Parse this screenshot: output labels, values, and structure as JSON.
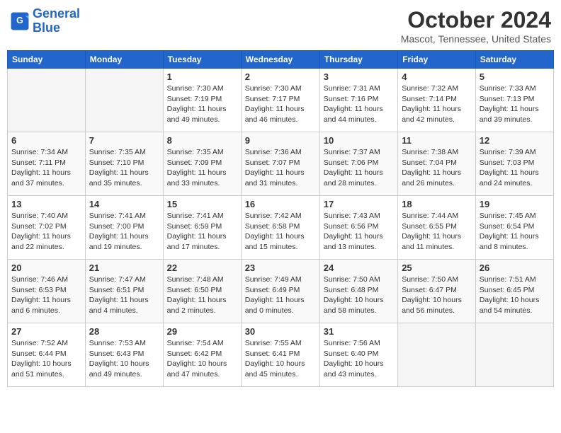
{
  "header": {
    "logo_line1": "General",
    "logo_line2": "Blue",
    "month": "October 2024",
    "location": "Mascot, Tennessee, United States"
  },
  "days_of_week": [
    "Sunday",
    "Monday",
    "Tuesday",
    "Wednesday",
    "Thursday",
    "Friday",
    "Saturday"
  ],
  "weeks": [
    [
      {
        "num": "",
        "sunrise": "",
        "sunset": "",
        "daylight": "",
        "empty": true
      },
      {
        "num": "",
        "sunrise": "",
        "sunset": "",
        "daylight": "",
        "empty": true
      },
      {
        "num": "1",
        "sunrise": "Sunrise: 7:30 AM",
        "sunset": "Sunset: 7:19 PM",
        "daylight": "Daylight: 11 hours and 49 minutes."
      },
      {
        "num": "2",
        "sunrise": "Sunrise: 7:30 AM",
        "sunset": "Sunset: 7:17 PM",
        "daylight": "Daylight: 11 hours and 46 minutes."
      },
      {
        "num": "3",
        "sunrise": "Sunrise: 7:31 AM",
        "sunset": "Sunset: 7:16 PM",
        "daylight": "Daylight: 11 hours and 44 minutes."
      },
      {
        "num": "4",
        "sunrise": "Sunrise: 7:32 AM",
        "sunset": "Sunset: 7:14 PM",
        "daylight": "Daylight: 11 hours and 42 minutes."
      },
      {
        "num": "5",
        "sunrise": "Sunrise: 7:33 AM",
        "sunset": "Sunset: 7:13 PM",
        "daylight": "Daylight: 11 hours and 39 minutes."
      }
    ],
    [
      {
        "num": "6",
        "sunrise": "Sunrise: 7:34 AM",
        "sunset": "Sunset: 7:11 PM",
        "daylight": "Daylight: 11 hours and 37 minutes."
      },
      {
        "num": "7",
        "sunrise": "Sunrise: 7:35 AM",
        "sunset": "Sunset: 7:10 PM",
        "daylight": "Daylight: 11 hours and 35 minutes."
      },
      {
        "num": "8",
        "sunrise": "Sunrise: 7:35 AM",
        "sunset": "Sunset: 7:09 PM",
        "daylight": "Daylight: 11 hours and 33 minutes."
      },
      {
        "num": "9",
        "sunrise": "Sunrise: 7:36 AM",
        "sunset": "Sunset: 7:07 PM",
        "daylight": "Daylight: 11 hours and 31 minutes."
      },
      {
        "num": "10",
        "sunrise": "Sunrise: 7:37 AM",
        "sunset": "Sunset: 7:06 PM",
        "daylight": "Daylight: 11 hours and 28 minutes."
      },
      {
        "num": "11",
        "sunrise": "Sunrise: 7:38 AM",
        "sunset": "Sunset: 7:04 PM",
        "daylight": "Daylight: 11 hours and 26 minutes."
      },
      {
        "num": "12",
        "sunrise": "Sunrise: 7:39 AM",
        "sunset": "Sunset: 7:03 PM",
        "daylight": "Daylight: 11 hours and 24 minutes."
      }
    ],
    [
      {
        "num": "13",
        "sunrise": "Sunrise: 7:40 AM",
        "sunset": "Sunset: 7:02 PM",
        "daylight": "Daylight: 11 hours and 22 minutes."
      },
      {
        "num": "14",
        "sunrise": "Sunrise: 7:41 AM",
        "sunset": "Sunset: 7:00 PM",
        "daylight": "Daylight: 11 hours and 19 minutes."
      },
      {
        "num": "15",
        "sunrise": "Sunrise: 7:41 AM",
        "sunset": "Sunset: 6:59 PM",
        "daylight": "Daylight: 11 hours and 17 minutes."
      },
      {
        "num": "16",
        "sunrise": "Sunrise: 7:42 AM",
        "sunset": "Sunset: 6:58 PM",
        "daylight": "Daylight: 11 hours and 15 minutes."
      },
      {
        "num": "17",
        "sunrise": "Sunrise: 7:43 AM",
        "sunset": "Sunset: 6:56 PM",
        "daylight": "Daylight: 11 hours and 13 minutes."
      },
      {
        "num": "18",
        "sunrise": "Sunrise: 7:44 AM",
        "sunset": "Sunset: 6:55 PM",
        "daylight": "Daylight: 11 hours and 11 minutes."
      },
      {
        "num": "19",
        "sunrise": "Sunrise: 7:45 AM",
        "sunset": "Sunset: 6:54 PM",
        "daylight": "Daylight: 11 hours and 8 minutes."
      }
    ],
    [
      {
        "num": "20",
        "sunrise": "Sunrise: 7:46 AM",
        "sunset": "Sunset: 6:53 PM",
        "daylight": "Daylight: 11 hours and 6 minutes."
      },
      {
        "num": "21",
        "sunrise": "Sunrise: 7:47 AM",
        "sunset": "Sunset: 6:51 PM",
        "daylight": "Daylight: 11 hours and 4 minutes."
      },
      {
        "num": "22",
        "sunrise": "Sunrise: 7:48 AM",
        "sunset": "Sunset: 6:50 PM",
        "daylight": "Daylight: 11 hours and 2 minutes."
      },
      {
        "num": "23",
        "sunrise": "Sunrise: 7:49 AM",
        "sunset": "Sunset: 6:49 PM",
        "daylight": "Daylight: 11 hours and 0 minutes."
      },
      {
        "num": "24",
        "sunrise": "Sunrise: 7:50 AM",
        "sunset": "Sunset: 6:48 PM",
        "daylight": "Daylight: 10 hours and 58 minutes."
      },
      {
        "num": "25",
        "sunrise": "Sunrise: 7:50 AM",
        "sunset": "Sunset: 6:47 PM",
        "daylight": "Daylight: 10 hours and 56 minutes."
      },
      {
        "num": "26",
        "sunrise": "Sunrise: 7:51 AM",
        "sunset": "Sunset: 6:45 PM",
        "daylight": "Daylight: 10 hours and 54 minutes."
      }
    ],
    [
      {
        "num": "27",
        "sunrise": "Sunrise: 7:52 AM",
        "sunset": "Sunset: 6:44 PM",
        "daylight": "Daylight: 10 hours and 51 minutes."
      },
      {
        "num": "28",
        "sunrise": "Sunrise: 7:53 AM",
        "sunset": "Sunset: 6:43 PM",
        "daylight": "Daylight: 10 hours and 49 minutes."
      },
      {
        "num": "29",
        "sunrise": "Sunrise: 7:54 AM",
        "sunset": "Sunset: 6:42 PM",
        "daylight": "Daylight: 10 hours and 47 minutes."
      },
      {
        "num": "30",
        "sunrise": "Sunrise: 7:55 AM",
        "sunset": "Sunset: 6:41 PM",
        "daylight": "Daylight: 10 hours and 45 minutes."
      },
      {
        "num": "31",
        "sunrise": "Sunrise: 7:56 AM",
        "sunset": "Sunset: 6:40 PM",
        "daylight": "Daylight: 10 hours and 43 minutes."
      },
      {
        "num": "",
        "sunrise": "",
        "sunset": "",
        "daylight": "",
        "empty": true
      },
      {
        "num": "",
        "sunrise": "",
        "sunset": "",
        "daylight": "",
        "empty": true
      }
    ]
  ]
}
